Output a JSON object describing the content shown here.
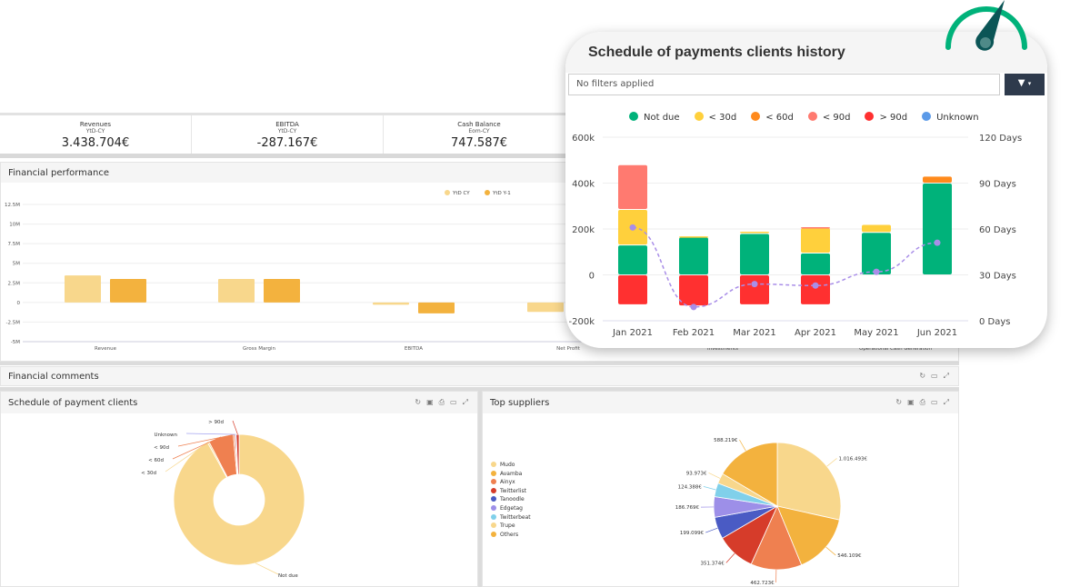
{
  "kpis": [
    {
      "title": "Revenues",
      "sub": "YtD-CY",
      "value": "3.438.704€"
    },
    {
      "title": "EBITDA",
      "sub": "YtD-CY",
      "value": "-287.167€"
    },
    {
      "title": "Cash Balance",
      "sub": "Eom-CY",
      "value": "747.587€"
    }
  ],
  "panels": {
    "financial_performance": "Financial performance",
    "financial_comments": "Financial comments",
    "schedule_clients": "Schedule of payment clients",
    "top_suppliers": "Top suppliers"
  },
  "popup": {
    "title": "Schedule of payments clients history",
    "filter_placeholder": "No filters applied",
    "filter_icon": "filter-icon",
    "caret_icon": "caret-down-icon"
  },
  "colors": {
    "accent": "#00b27a",
    "filter_button": "#2e3a4c",
    "gauge": "#00b27a",
    "gauge_needle": "#0b5556"
  },
  "chart_data": [
    {
      "type": "bar",
      "title": "Financial performance",
      "categories": [
        "Revenue",
        "Gross Margin",
        "EBITDA",
        "Net Profit",
        "Investments",
        "Operational Cash Generation"
      ],
      "series": [
        {
          "name": "YtD CY",
          "color": "#f8d78c",
          "values": [
            3.44,
            3.0,
            -0.29,
            -1.2,
            null,
            null
          ]
        },
        {
          "name": "YtD Y-1",
          "color": "#f3b23e",
          "values": [
            3.0,
            3.0,
            -1.4,
            null,
            null,
            null
          ]
        }
      ],
      "yticks": [
        "12.5M",
        "10M",
        "7.5M",
        "5M",
        "2.5M",
        "0",
        "-2.5M",
        "-5M"
      ],
      "ylim": [
        -5,
        12.5
      ],
      "grid": true,
      "legend": "top-right"
    },
    {
      "type": "bar",
      "stacked": true,
      "title": "Schedule of payments clients history",
      "categories": [
        "Jan 2021",
        "Feb 2021",
        "Mar 2021",
        "Apr 2021",
        "May 2021",
        "Jun 2021"
      ],
      "series": [
        {
          "name": "Not due",
          "color": "#00b27a",
          "values": [
            130000,
            165000,
            180000,
            95000,
            185000,
            400000
          ]
        },
        {
          "name": "< 30d",
          "color": "#ffd03c",
          "values": [
            155000,
            5000,
            10000,
            110000,
            35000,
            0
          ]
        },
        {
          "name": "< 60d",
          "color": "#ff8a1c",
          "values": [
            0,
            0,
            0,
            0,
            0,
            30000
          ]
        },
        {
          "name": "< 90d",
          "color": "#ff7a70",
          "values": [
            195000,
            0,
            0,
            5000,
            0,
            0
          ]
        },
        {
          "name": "> 90d",
          "color": "#ff3030",
          "values": [
            -130000,
            -135000,
            -130000,
            -130000,
            0,
            0
          ]
        },
        {
          "name": "Unknown",
          "color": "#5b9ae8",
          "values": [
            0,
            0,
            0,
            0,
            0,
            0
          ]
        }
      ],
      "line": {
        "color": "#a98ee8",
        "values": [
          61,
          9,
          24,
          23,
          32,
          51
        ],
        "unit": "Days"
      },
      "yticks": [
        "600k",
        "400k",
        "200k",
        "0",
        "-200k"
      ],
      "ylim": [
        -200000,
        600000
      ],
      "y2ticks": [
        "120 Days",
        "90 Days",
        "60 Days",
        "30 Days",
        "0 Days"
      ],
      "y2lim": [
        0,
        120
      ],
      "grid": true,
      "legend": "top"
    },
    {
      "type": "pie",
      "donut": true,
      "title": "Schedule of payment clients",
      "labels": [
        "Not due",
        "< 30d",
        "< 60d",
        "< 90d",
        "Unknown",
        "> 90d"
      ],
      "values": [
        92,
        0.4,
        6.2,
        0.4,
        0.3,
        0.7
      ],
      "colors": [
        "#f8d78c",
        "#f8d78c",
        "#ef8050",
        "#ef8050",
        "#a4a4f0",
        "#d63c2a"
      ]
    },
    {
      "type": "pie",
      "title": "Top suppliers",
      "labels": [
        "Mudo",
        "Avamba",
        "Ainyx",
        "Twitterlist",
        "Tanoodle",
        "Edgetag",
        "Twitterbeat",
        "Trupe",
        "Others"
      ],
      "values": [
        1016493,
        546109,
        462723,
        351374,
        199099,
        186769,
        124388,
        93973,
        588219
      ],
      "value_labels": [
        "1.016.493€",
        "546.109€",
        "462.723€",
        "351.374€",
        "199.099€",
        "186.769€",
        "124.388€",
        "93.973€",
        "588.219€"
      ],
      "colors": [
        "#f8d78c",
        "#f3b23e",
        "#ef8050",
        "#d63c2a",
        "#4a5bc4",
        "#9d8fe8",
        "#80d0ea",
        "#f8d78c",
        "#f3b23e"
      ],
      "legend": "left"
    }
  ]
}
